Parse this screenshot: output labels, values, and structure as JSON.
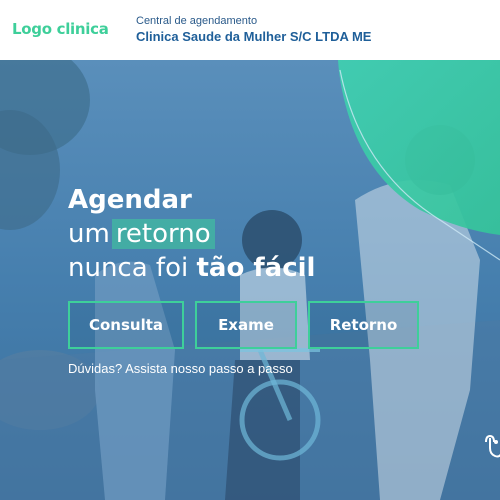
{
  "header": {
    "logo": "Logo clinica",
    "schedule_label": "Central de agendamento",
    "clinic_name": "Clinica Saude da Mulher S/C LTDA ME"
  },
  "hero": {
    "headline_line1": "Agendar",
    "headline_line2_prefix": "um",
    "headline_line2_highlight": "retorno",
    "headline_line3_prefix": "nunca foi",
    "headline_line3_bold": "tão fácil"
  },
  "actions": {
    "consulta": "Consulta",
    "exame": "Exame",
    "retorno": "Retorno"
  },
  "help": {
    "link": "Dúvidas? Assista nosso passo a passo"
  },
  "colors": {
    "accent": "#3ecf9a",
    "brand_blue": "#1f5f99",
    "hero_overlay": "#3f7aa8"
  },
  "icons": {
    "corner": "accessibility-hand-icon"
  }
}
